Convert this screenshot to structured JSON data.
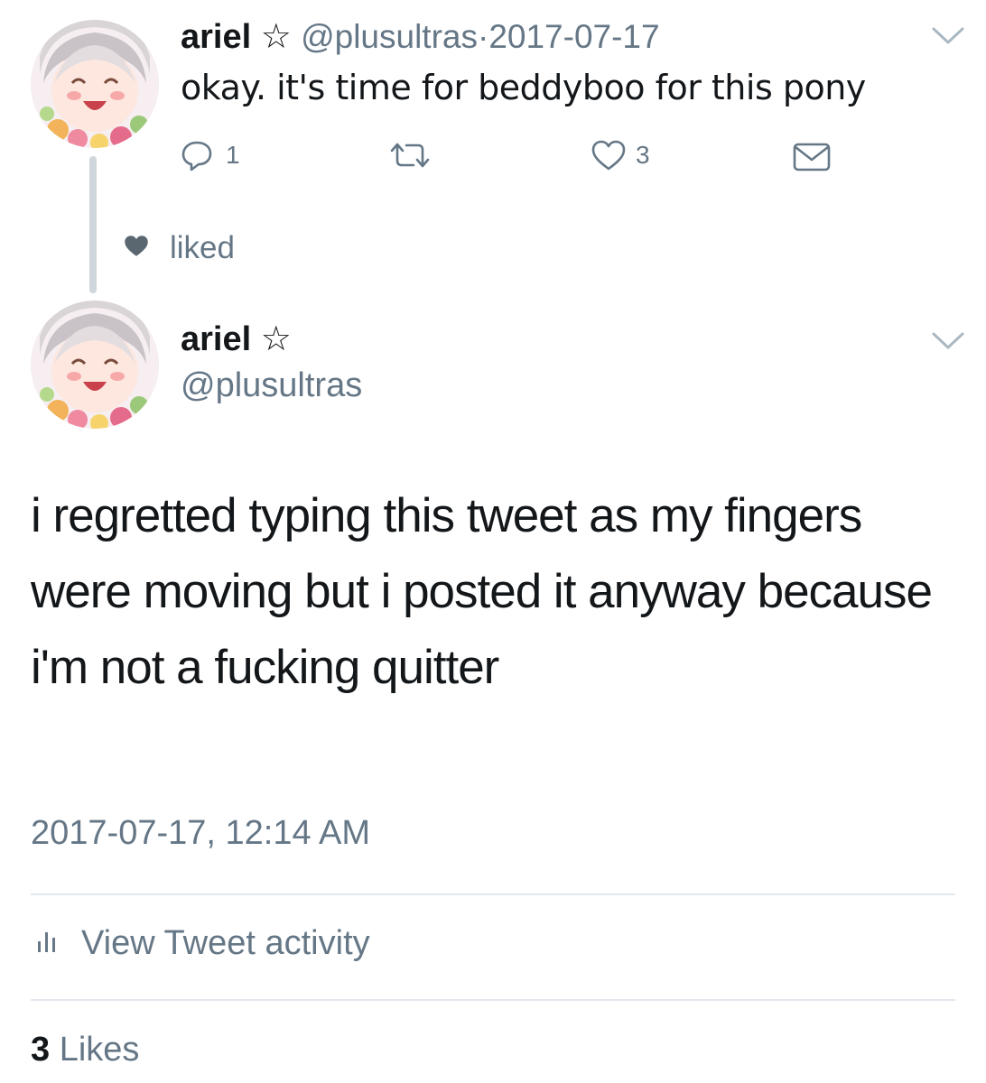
{
  "tweet1": {
    "name": "ariel ☆",
    "handle": "@plusultras",
    "separator": "·",
    "date": "2017-07-17",
    "text": "okay. it's time for beddyboo for this pony",
    "reply_count": "1",
    "like_count": "3"
  },
  "social_context": {
    "text": "liked"
  },
  "tweet2": {
    "name": "ariel ☆",
    "handle": "@plusultras",
    "text": "i regretted typing this tweet as my fingers were moving but i posted it anyway because i'm not a fucking quitter",
    "timestamp": "2017-07-17, 12:14 AM",
    "activity_label": "View Tweet activity",
    "likes_count": "3",
    "likes_label": "Likes"
  },
  "colors": {
    "text": "#14171a",
    "secondary": "#657786",
    "thread_line": "#cfd6dc",
    "divider": "#e1e8ed"
  }
}
